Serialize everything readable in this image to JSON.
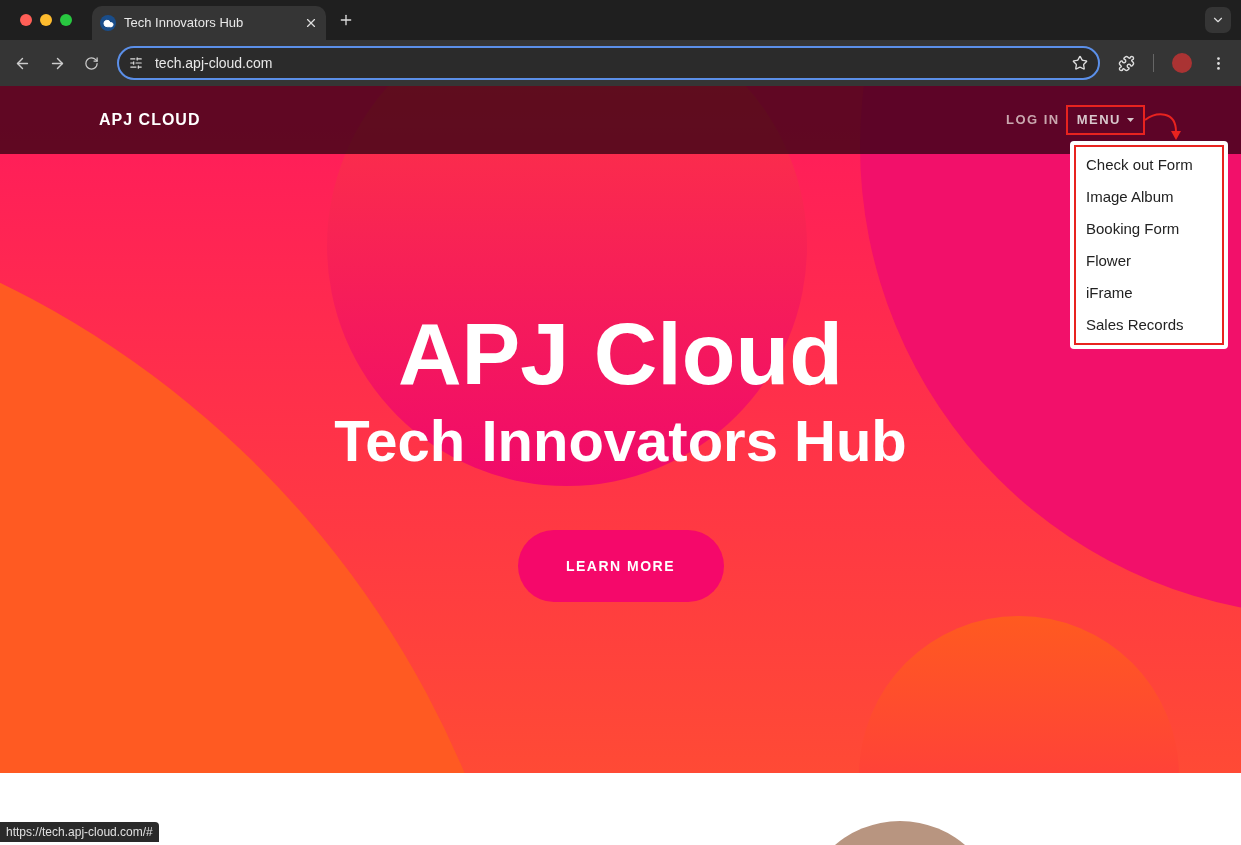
{
  "browser": {
    "tab_title": "Tech Innovators Hub",
    "url": "tech.apj-cloud.com",
    "status_url": "https://tech.apj-cloud.com/#"
  },
  "nav": {
    "brand": "APJ CLOUD",
    "login": "LOG IN",
    "menu": "MENU",
    "menu_expanded": true,
    "menu_items": [
      "Check out Form",
      "Image Album",
      "Booking Form",
      "Flower",
      "iFrame",
      "Sales Records"
    ]
  },
  "hero": {
    "title": "APJ Cloud",
    "subtitle": "Tech Innovators Hub",
    "button": "LEARN MORE"
  }
}
